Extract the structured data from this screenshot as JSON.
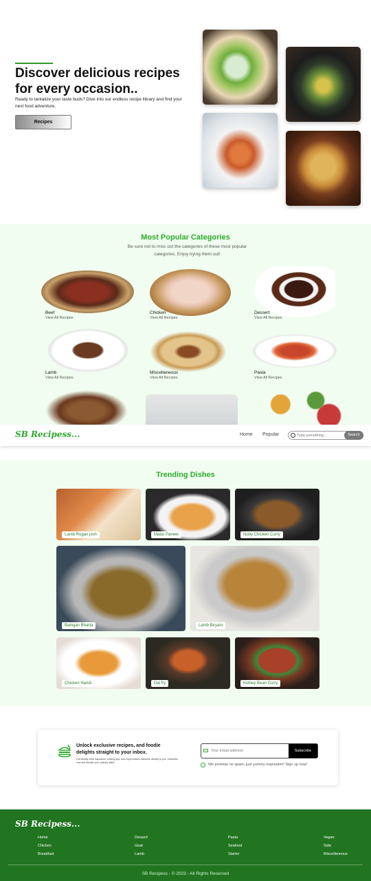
{
  "hero": {
    "title": "Discover delicious recipes for every occasion..",
    "subtitle": "Ready to tantalize your taste buds? Dive into our endless recipe library and find your next food adventure.",
    "button": "Recipes",
    "images": [
      "salad-image",
      "bowl-image",
      "plate-image",
      "biryani-image"
    ]
  },
  "categories": {
    "title": "Most Popular Categories",
    "subtitle": "Be sure not to miss out the categories of these most popular categories. Enjoy trying them out!",
    "items": [
      {
        "name": "Beef",
        "link": "View All Recipes"
      },
      {
        "name": "Chicken",
        "link": "View All Recipes"
      },
      {
        "name": "Dessert",
        "link": "View All Recipes"
      },
      {
        "name": "Lamb",
        "link": "View All Recipes"
      },
      {
        "name": "Miscellaneous",
        "link": "View All Recipes"
      },
      {
        "name": "Pasta",
        "link": "View All Recipes"
      }
    ]
  },
  "nav": {
    "logo": "SB Recipess...",
    "links": [
      "Home",
      "Popular"
    ],
    "search_placeholder": "Type something...",
    "search_button": "Search"
  },
  "trending": {
    "title": "Trending Dishes",
    "dishes": [
      "Lamb Rogan josh",
      "Matar Paneer",
      "Nutty Chicken Curry",
      "Baingan Bharta",
      "Lamb Biryani",
      "Chicken Handi",
      "Dal fry",
      "Kidney Bean Curry"
    ]
  },
  "newsletter": {
    "title": "Unlock exclusive recipes, and foodie delights straight to your inbox.",
    "text": "Get weekly meal inspiration, cooking tips, and expert advice delivered directly to you. Subscribe now and elevate your culinary skills!",
    "placeholder": "Your email address",
    "button": "Subscribe",
    "note": "We promise no spam, just yummy inspiration! Sign up now!"
  },
  "footer": {
    "logo": "SB Recipess...",
    "columns": [
      [
        "Home",
        "Chicken",
        "Breakfast"
      ],
      [
        "Dessert",
        "Goat",
        "Lamb"
      ],
      [
        "Pasta",
        "Seafood",
        "Starter"
      ],
      [
        "Vegan",
        "Side",
        "Miscellaneous"
      ]
    ],
    "copyright": "SB Recipess - © 2023 - All Rights Reserved"
  },
  "colors": {
    "accent": "#2eaa2e",
    "footer": "#217521",
    "section_bg": "#f1fdf0"
  }
}
